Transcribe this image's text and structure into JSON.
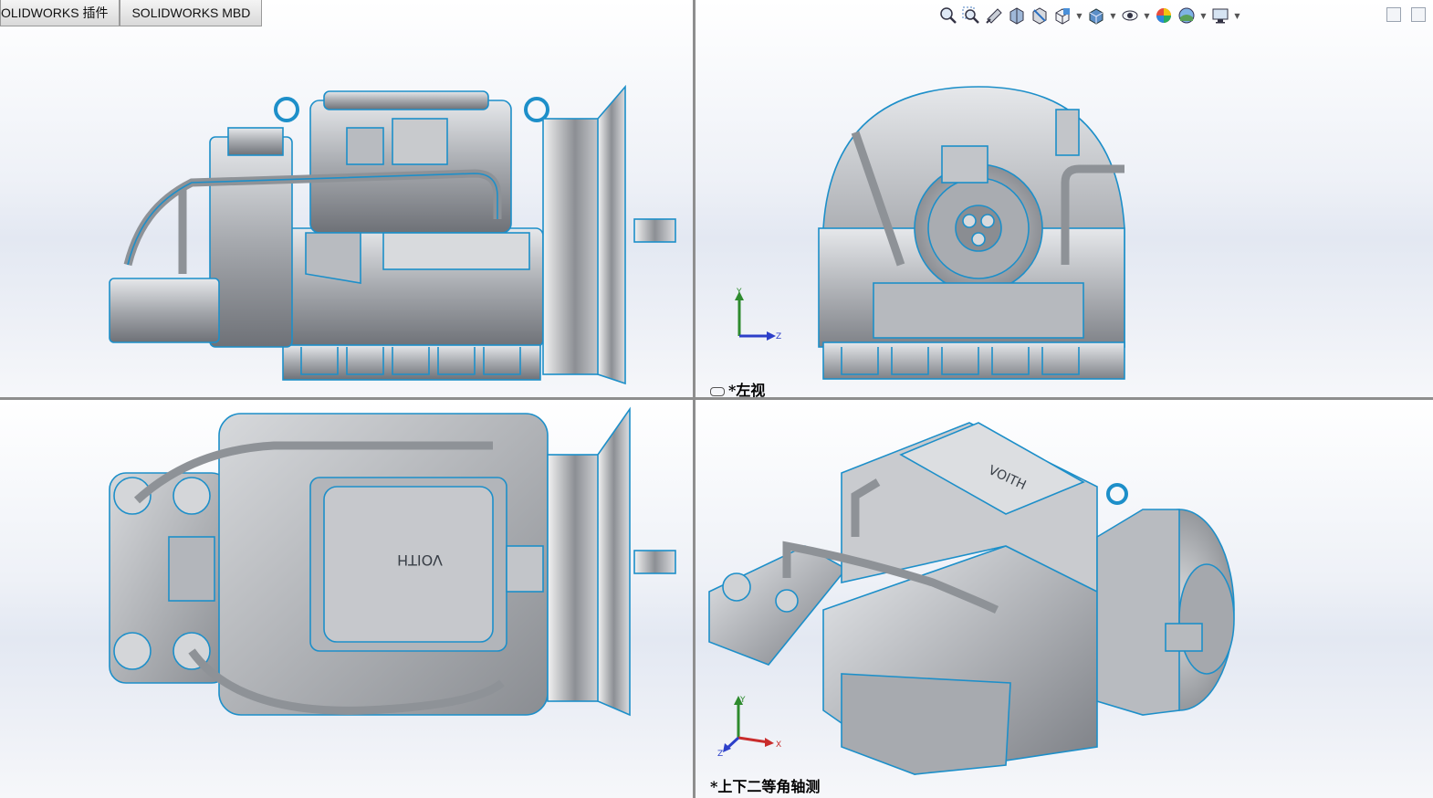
{
  "tabs": [
    {
      "label": "OLIDWORKS 插件"
    },
    {
      "label": "SOLIDWORKS MBD"
    }
  ],
  "heads_up_toolbar": {
    "icons": [
      "zoom-to-fit-icon",
      "zoom-to-area-icon",
      "previous-view-icon",
      "section-view-icon",
      "dynamic-annotation-icon",
      "view-orientation-icon",
      "display-style-icon",
      "hide-show-icon",
      "edit-appearance-icon",
      "apply-scene-icon",
      "view-settings-icon"
    ]
  },
  "viewports": {
    "top_left": {
      "label": ""
    },
    "top_right": {
      "label": "*左视",
      "link_icon": "viewport-link-icon",
      "triad_axes": {
        "y": "Y",
        "z": "Z"
      }
    },
    "bottom_left": {
      "label": ""
    },
    "bottom_right": {
      "label": "*上下二等角轴测",
      "triad_axes": {
        "y": "Y",
        "x": "X",
        "z": "Z"
      }
    }
  },
  "colors": {
    "edge": "#1d8fc9",
    "body": "#a8abb0",
    "background_top": "#ffffff",
    "background_mid": "#e3e8f2",
    "splitter": "#8e8e8e"
  },
  "model": {
    "brand_text": "VOITH"
  }
}
